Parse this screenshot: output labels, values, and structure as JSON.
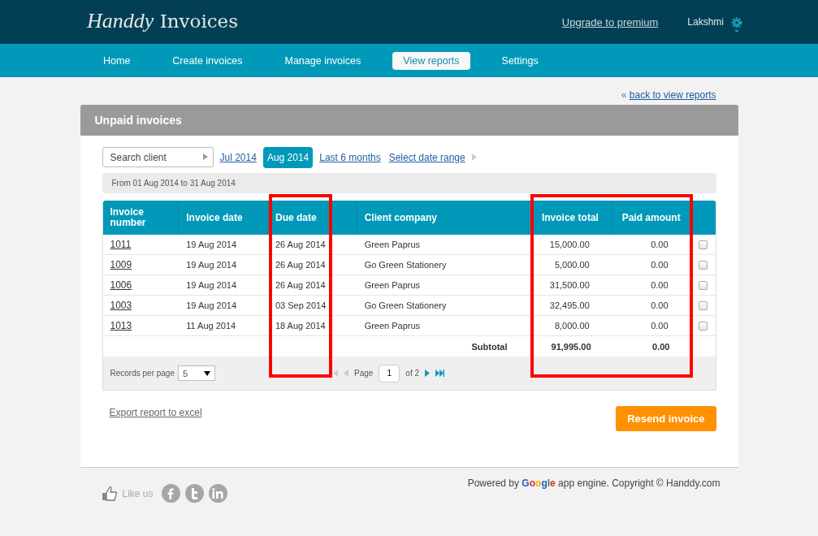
{
  "header": {
    "logo_script": "Handdy",
    "logo_text": "Invoices",
    "upgrade_link": "Upgrade to premium",
    "user": "Lakshmi"
  },
  "nav": [
    {
      "label": "Home",
      "selected": false
    },
    {
      "label": "Create invoices",
      "selected": false
    },
    {
      "label": "Manage invoices",
      "selected": false
    },
    {
      "label": "View reports",
      "selected": true
    },
    {
      "label": "Settings",
      "selected": false
    }
  ],
  "back_link": {
    "icon": "«",
    "label": "back to view reports"
  },
  "panel_title": "Unpaid invoices",
  "filters": {
    "search_placeholder": "Search client",
    "periods": [
      {
        "label": "Jul 2014",
        "selected": false
      },
      {
        "label": "Aug 2014",
        "selected": true
      },
      {
        "label": "Last 6 months",
        "selected": false
      },
      {
        "label": "Select date range",
        "selected": false
      }
    ],
    "range_text": "From 01 Aug 2014 to 31 Aug 2014"
  },
  "table": {
    "columns": [
      {
        "label": "Invoice number",
        "kind": "text",
        "highlighted": false
      },
      {
        "label": "Invoice date",
        "kind": "text",
        "highlighted": false
      },
      {
        "label": "Due date",
        "kind": "text",
        "highlighted": true
      },
      {
        "label": "Client company",
        "kind": "text",
        "highlighted": false
      },
      {
        "label": "Invoice total",
        "kind": "amount",
        "highlighted": true
      },
      {
        "label": "Paid amount",
        "kind": "amount",
        "highlighted": true
      }
    ],
    "rows": [
      {
        "cells": [
          "1011",
          "19 Aug 2014",
          "26 Aug 2014",
          "Green Paprus",
          "15,000.00",
          "0.00"
        ],
        "checked": false
      },
      {
        "cells": [
          "1009",
          "19 Aug 2014",
          "26 Aug 2014",
          "Go Green Stationery",
          "5,000.00",
          "0.00"
        ],
        "checked": false
      },
      {
        "cells": [
          "1006",
          "19 Aug 2014",
          "26 Aug 2014",
          "Green Paprus",
          "31,500.00",
          "0.00"
        ],
        "checked": false
      },
      {
        "cells": [
          "1003",
          "19 Aug 2014",
          "03 Sep 2014",
          "Go Green Stationery",
          "32,495.00",
          "0.00"
        ],
        "checked": false
      },
      {
        "cells": [
          "1013",
          "11 Aug 2014",
          "18 Aug 2014",
          "Green Paprus",
          "8,000.00",
          "0.00"
        ],
        "checked": false
      }
    ],
    "subtotal": {
      "label": "Subtotal",
      "invoice_total": "91,995.00",
      "paid_amount": "0.00"
    },
    "pager": {
      "records_label": "Records per page",
      "records_value": "5",
      "page_label": "Page",
      "page_value": "1",
      "of_label": "of 2"
    }
  },
  "export_link": "Export report to excel",
  "resend_button": "Resend invoice",
  "footer": {
    "like_label": "Like us",
    "powered_prefix": "Powered by",
    "google": "Google",
    "powered_suffix": "app engine. Copyright © Handdy.com"
  }
}
